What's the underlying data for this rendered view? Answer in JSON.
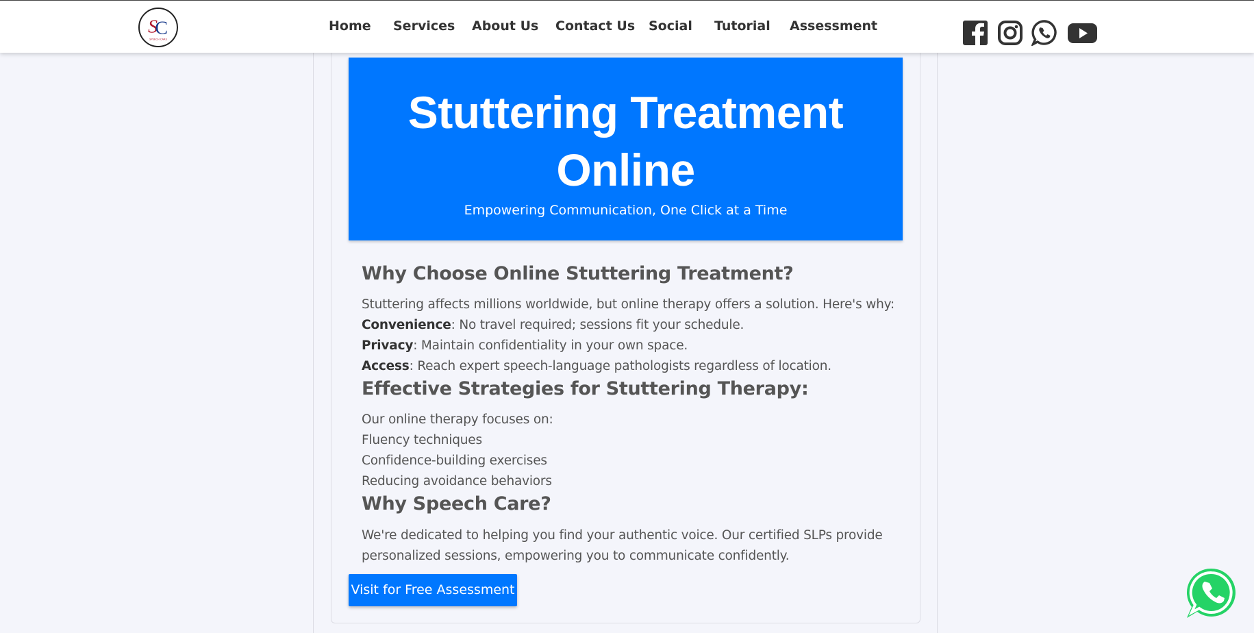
{
  "logo": {
    "text": "SC",
    "subtext": "SPEECH CARE"
  },
  "nav": {
    "items": [
      {
        "label": "Home"
      },
      {
        "label": "Services"
      },
      {
        "label": "About Us"
      },
      {
        "label": "Contact Us"
      },
      {
        "label": "Social"
      },
      {
        "label": "Tutorial"
      },
      {
        "label": "Assessment"
      }
    ],
    "social_icons": [
      "facebook-icon",
      "instagram-icon",
      "whatsapp-icon",
      "youtube-icon"
    ]
  },
  "hero": {
    "title_line1": "Stuttering Treatment",
    "title_line2": "Online",
    "subtitle": "Empowering Communication, One Click at a Time"
  },
  "section1": {
    "heading": "Why Choose Online Stuttering Treatment?",
    "intro": "Stuttering affects millions worldwide, but online therapy offers a solution. Here's why:",
    "points": [
      {
        "term": "Convenience",
        "text": ": No travel required; sessions fit your schedule."
      },
      {
        "term": "Privacy",
        "text": ": Maintain confidentiality in your own space."
      },
      {
        "term": "Access",
        "text": ": Reach expert speech-language pathologists regardless of location."
      }
    ]
  },
  "section2": {
    "heading": "Effective Strategies for Stuttering Therapy:",
    "intro": "Our online therapy focuses on:",
    "items": [
      "Fluency techniques",
      "Confidence-building exercises",
      "Reducing avoidance behaviors"
    ]
  },
  "section3": {
    "heading": "Why Speech Care?",
    "line1": "We're dedicated to helping you find your authentic voice. Our certified SLPs provide",
    "line2": "personalized sessions, empowering you to communicate confidently."
  },
  "cta": {
    "label": "Visit for Free Assessment"
  },
  "colors": {
    "primary": "#0077ff",
    "whatsapp": "#25d366",
    "background": "#f4f5fb"
  }
}
